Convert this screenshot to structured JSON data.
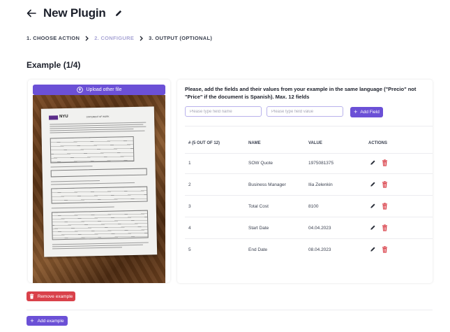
{
  "header": {
    "title": "New Plugin",
    "back_icon": "arrow-left-icon",
    "edit_icon": "pencil-icon"
  },
  "steps": [
    {
      "label": "1. CHOOSE ACTION",
      "active": false
    },
    {
      "label": "2. CONFIGURE",
      "active": true
    },
    {
      "label": "3. OUTPUT (OPTIONAL)",
      "active": false
    }
  ],
  "section_title": "Example (1/4)",
  "upload": {
    "label": "Upload other file",
    "icon": "upload-icon"
  },
  "document_preview": {
    "logo_text": "NYU",
    "doc_title": "STATEMENT OF WORK"
  },
  "instructions": "Please, add the fields and their values from your example in the same language (\"Precio\" not \"Price\" if the document is Spanish). Max. 12 fields",
  "field_name_input": {
    "placeholder": "Please type field name",
    "value": ""
  },
  "field_value_input": {
    "placeholder": "Please type field value",
    "value": ""
  },
  "add_field_label": "Add Field",
  "table": {
    "headers": [
      "# (5 OUT OF 12)",
      "NAME",
      "VALUE",
      "ACTIONS"
    ],
    "rows": [
      {
        "index": "1",
        "name": "SOW Quote",
        "value": "1975081375"
      },
      {
        "index": "2",
        "name": "Business Manager",
        "value": "Ilia Zelenkin"
      },
      {
        "index": "3",
        "name": "Total Cost",
        "value": "8100"
      },
      {
        "index": "4",
        "name": "Start Date",
        "value": "04.04.2023"
      },
      {
        "index": "5",
        "name": "End Date",
        "value": "08.04.2023"
      }
    ]
  },
  "remove_example_label": "Remove example",
  "add_example_label": "Add example",
  "colors": {
    "accent": "#6b50d6",
    "danger": "#d9414a",
    "step_active": "#a9a6d6"
  }
}
